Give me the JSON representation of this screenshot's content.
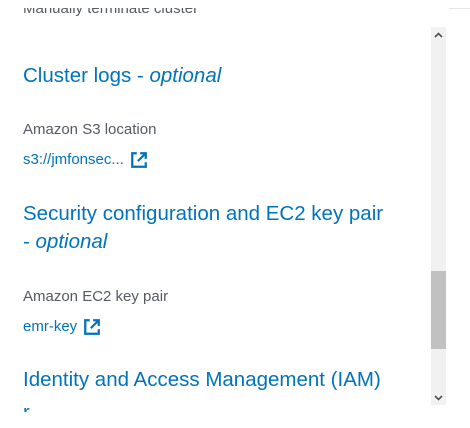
{
  "cutoff_top_text": "Manually terminate cluster",
  "sections": {
    "cluster_logs": {
      "title": "Cluster logs - ",
      "optional": "optional",
      "field_label": "Amazon S3 location",
      "link_text": "s3://jmfonsec..."
    },
    "security": {
      "title_line1": "Security configuration and EC2 key pair",
      "title_line2_prefix": "- ",
      "optional": "optional",
      "field_label": "Amazon EC2 key pair",
      "link_text": "emr-key"
    },
    "iam": {
      "title": "Identity and Access Management (IAM)",
      "cut_text": "r"
    }
  },
  "icons": {
    "external_link": "external-link-icon",
    "scroll_up": "chevron-up-icon",
    "scroll_down": "chevron-down-icon"
  },
  "colors": {
    "link": "#0073bb",
    "label": "#545b64",
    "scroll_track": "#f1f1f1",
    "scroll_thumb": "#c1c1c1"
  }
}
